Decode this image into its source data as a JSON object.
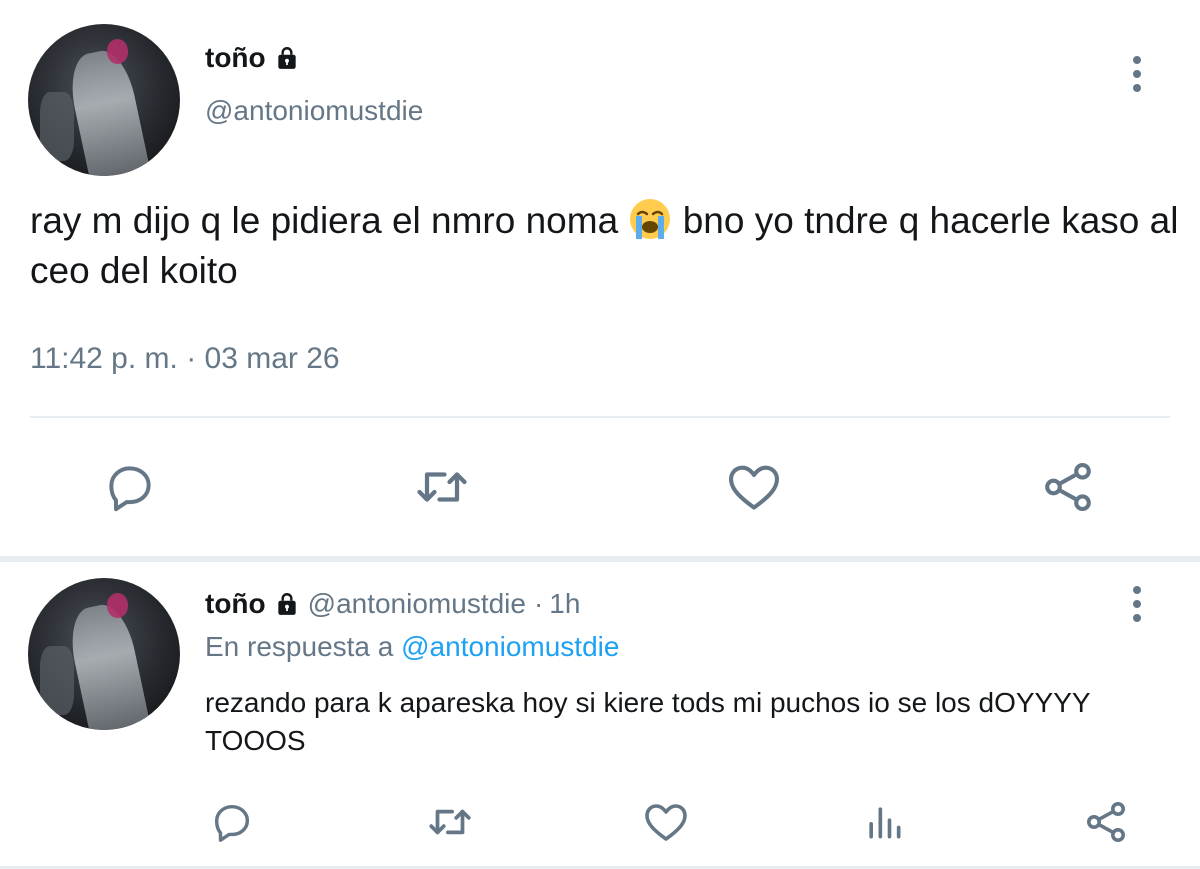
{
  "main_tweet": {
    "display_name": "toño",
    "handle": "@antoniomustdie",
    "text_part1": "ray m dijo q le pidiera el nmro noma ",
    "emoji": "loudly-crying-face",
    "text_part2": " bno yo tndre q hacerle kaso al ceo del koito",
    "timestamp": "11:42 p. m. · 03 mar 26",
    "actions": [
      "reply-icon",
      "retweet-icon",
      "like-icon",
      "share-icon"
    ]
  },
  "reply_tweet": {
    "display_name": "toño",
    "handle": "@antoniomustdie",
    "time_sep": "·",
    "time": "1h",
    "reply_prefix": "En respuesta a ",
    "reply_to": "@antoniomustdie",
    "text": "rezando para k apareska hoy si kiere tods mi puchos io se los dOYYYY TOOOS",
    "actions": [
      "reply-icon",
      "retweet-icon",
      "like-icon",
      "analytics-icon",
      "share-icon"
    ]
  },
  "colors": {
    "text": "#14171a",
    "secondary": "#657786",
    "link": "#1da1f2",
    "divider": "#e6ecf0"
  }
}
